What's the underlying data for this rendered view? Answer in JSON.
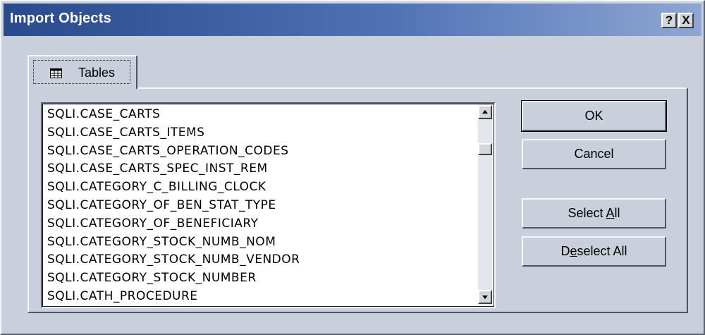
{
  "window": {
    "title": "Import Objects",
    "help_glyph": "?",
    "close_glyph": "X"
  },
  "tabs": [
    {
      "label": "Tables",
      "icon": "table-icon",
      "selected": true
    }
  ],
  "list": {
    "items": [
      "SQLI.CASE_CARTS",
      "SQLI.CASE_CARTS_ITEMS",
      "SQLI.CASE_CARTS_OPERATION_CODES",
      "SQLI.CASE_CARTS_SPEC_INST_REM",
      "SQLI.CATEGORY_C_BILLING_CLOCK",
      "SQLI.CATEGORY_OF_BEN_STAT_TYPE",
      "SQLI.CATEGORY_OF_BENEFICIARY",
      "SQLI.CATEGORY_STOCK_NUMB_NOM",
      "SQLI.CATEGORY_STOCK_NUMB_VENDOR",
      "SQLI.CATEGORY_STOCK_NUMBER",
      "SQLI.CATH_PROCEDURE"
    ]
  },
  "buttons": {
    "ok": "OK",
    "cancel": "Cancel",
    "select_all_pre": "Select ",
    "select_all_key": "A",
    "select_all_post": "ll",
    "deselect_all_pre": "D",
    "deselect_all_key": "e",
    "deselect_all_post": "select All"
  },
  "colors": {
    "titlebar_start": "#294a8c",
    "titlebar_end": "#8fa6d3",
    "face": "#c9d0dc"
  }
}
